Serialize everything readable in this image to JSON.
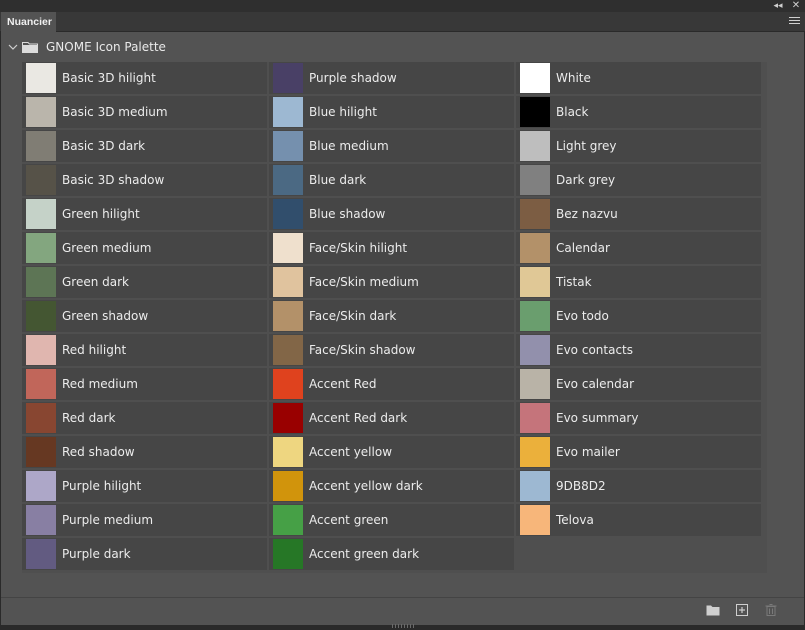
{
  "panel": {
    "tab_label": "Nuancier",
    "group_title": "GNOME Icon Palette"
  },
  "icons": {
    "collapse": "double-chevron-left-icon",
    "close": "close-icon",
    "menu": "hamburger-menu-icon",
    "group_toggle": "chevron-down-icon",
    "group_folder": "folder-icon",
    "new_group": "new-folder-icon",
    "new_swatch": "new-swatch-icon",
    "delete": "trash-icon"
  },
  "swatches": {
    "col1": [
      {
        "name": "Basic 3D hilight",
        "color": "#EAE8E3"
      },
      {
        "name": "Basic 3D medium",
        "color": "#BAB5AB"
      },
      {
        "name": "Basic 3D dark",
        "color": "#807D74"
      },
      {
        "name": "Basic 3D shadow",
        "color": "#565248"
      },
      {
        "name": "Green hilight",
        "color": "#C5D2C8"
      },
      {
        "name": "Green medium",
        "color": "#83A67F"
      },
      {
        "name": "Green dark",
        "color": "#5D7555"
      },
      {
        "name": "Green shadow",
        "color": "#445632"
      },
      {
        "name": "Red hilight",
        "color": "#E0B6AF"
      },
      {
        "name": "Red medium",
        "color": "#C1665A"
      },
      {
        "name": "Red dark",
        "color": "#884631"
      },
      {
        "name": "Red shadow",
        "color": "#663822"
      },
      {
        "name": "Purple hilight",
        "color": "#ADA7C8"
      },
      {
        "name": "Purple medium",
        "color": "#887FA3"
      },
      {
        "name": "Purple dark",
        "color": "#625B81"
      }
    ],
    "col2": [
      {
        "name": "Purple shadow",
        "color": "#494066"
      },
      {
        "name": "Blue hilight",
        "color": "#9DB8D2"
      },
      {
        "name": "Blue medium",
        "color": "#7590AE"
      },
      {
        "name": "Blue dark",
        "color": "#4B6983"
      },
      {
        "name": "Blue shadow",
        "color": "#314E6C"
      },
      {
        "name": "Face/Skin hilight",
        "color": "#EFE0CD"
      },
      {
        "name": "Face/Skin medium",
        "color": "#E0C39E"
      },
      {
        "name": "Face/Skin dark",
        "color": "#B39169"
      },
      {
        "name": "Face/Skin shadow",
        "color": "#826647"
      },
      {
        "name": "Accent Red",
        "color": "#DF421E"
      },
      {
        "name": "Accent Red dark",
        "color": "#990000"
      },
      {
        "name": "Accent yellow",
        "color": "#EED680"
      },
      {
        "name": "Accent yellow dark",
        "color": "#D1940C"
      },
      {
        "name": "Accent green",
        "color": "#46A046"
      },
      {
        "name": "Accent green dark",
        "color": "#267726"
      }
    ],
    "col3": [
      {
        "name": "White",
        "color": "#FFFFFF"
      },
      {
        "name": "Black",
        "color": "#000000"
      },
      {
        "name": "Light grey",
        "color": "#BEBEBE"
      },
      {
        "name": "Dark grey",
        "color": "#808080"
      },
      {
        "name": "Bez nazvu",
        "color": "#7C5D43"
      },
      {
        "name": "Calendar",
        "color": "#B39169"
      },
      {
        "name": "Tistak",
        "color": "#E0C896"
      },
      {
        "name": "Evo todo",
        "color": "#6A9E6E"
      },
      {
        "name": "Evo contacts",
        "color": "#9290AC"
      },
      {
        "name": "Evo calendar",
        "color": "#B9B3A7"
      },
      {
        "name": "Evo summary",
        "color": "#C5747B"
      },
      {
        "name": "Evo mailer",
        "color": "#EBB03B"
      },
      {
        "name": "9DB8D2",
        "color": "#9DB8D2"
      },
      {
        "name": "Telova",
        "color": "#F7B67A"
      }
    ]
  }
}
